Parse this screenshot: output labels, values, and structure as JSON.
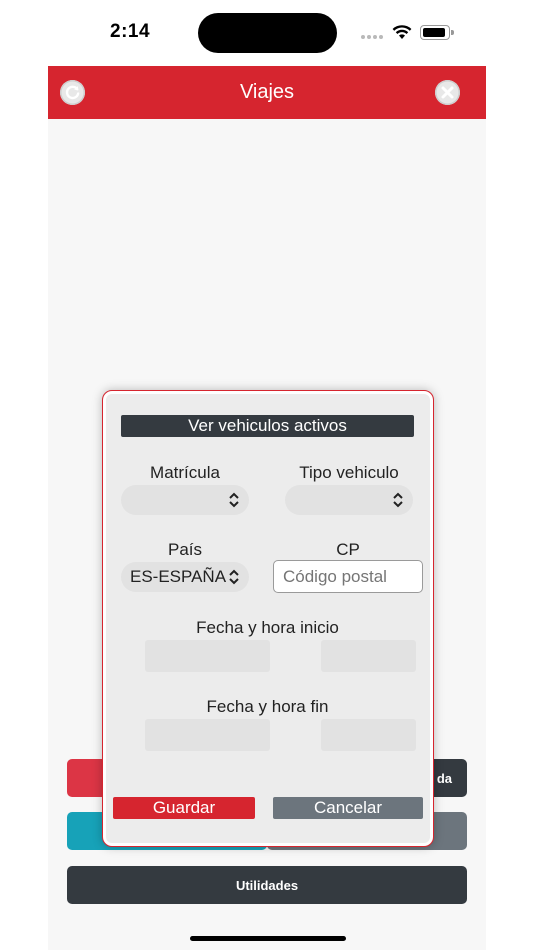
{
  "status": {
    "time": "2:14"
  },
  "nav": {
    "title": "Viajes",
    "refresh_icon": "refresh-icon",
    "close_icon": "close-icon"
  },
  "background_buttons": {
    "red": "",
    "dark": "da",
    "teal": "",
    "gray": "",
    "utilities": "Utilidades"
  },
  "modal": {
    "title": "Ver vehiculos activos",
    "matricula": {
      "label": "Matrícula",
      "value": ""
    },
    "tipo_vehiculo": {
      "label": "Tipo vehiculo",
      "value": ""
    },
    "pais": {
      "label": "País",
      "value": "ES-ESPAÑA"
    },
    "cp": {
      "label": "CP",
      "placeholder": "Código postal",
      "value": ""
    },
    "fecha_inicio": {
      "label": "Fecha y hora inicio",
      "date": "",
      "time": ""
    },
    "fecha_fin": {
      "label": "Fecha y hora fin",
      "date": "",
      "time": ""
    },
    "save_label": "Guardar",
    "cancel_label": "Cancelar"
  },
  "colors": {
    "brand_red": "#d6252f",
    "dark": "#343a40",
    "teal": "#17a2b8",
    "gray": "#6c757d"
  }
}
